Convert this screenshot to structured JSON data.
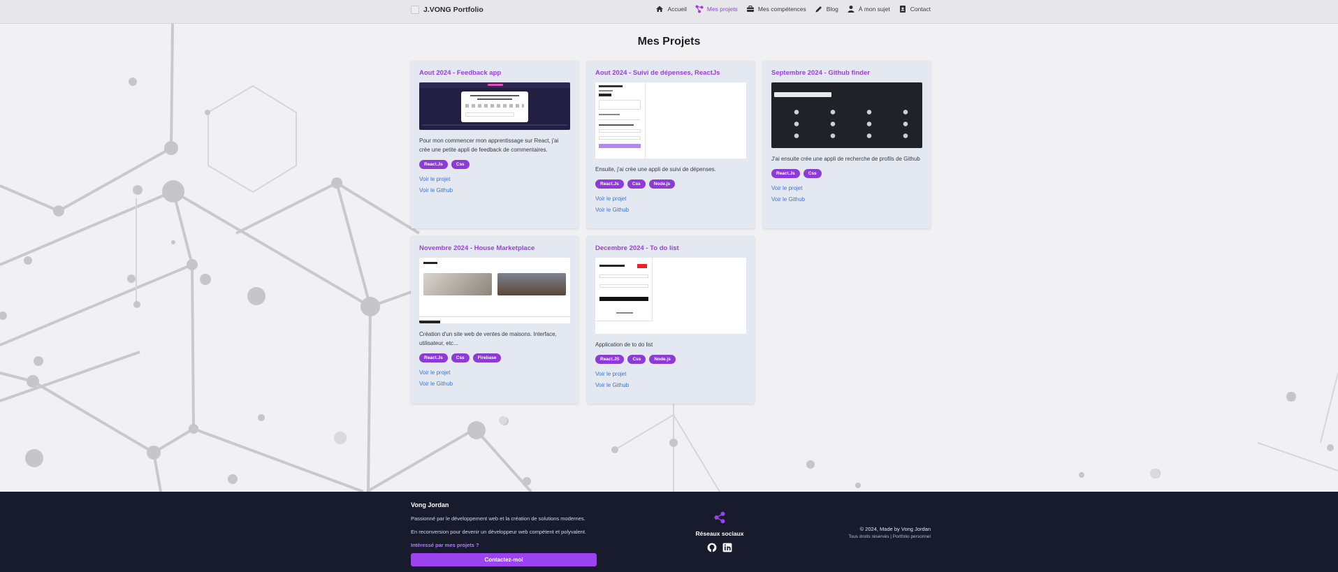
{
  "header": {
    "brand": "J.VONG Portfolio",
    "nav": [
      {
        "label": "Accueil",
        "icon": "home-icon",
        "active": false
      },
      {
        "label": "Mes projets",
        "icon": "share-nodes-icon",
        "active": true
      },
      {
        "label": "Mes compétences",
        "icon": "briefcase-icon",
        "active": false
      },
      {
        "label": "Blog",
        "icon": "pencil-icon",
        "active": false
      },
      {
        "label": "À mon sujet",
        "icon": "user-icon",
        "active": false
      },
      {
        "label": "Contact",
        "icon": "contact-book-icon",
        "active": false
      }
    ]
  },
  "main": {
    "title": "Mes Projets",
    "projects": [
      {
        "title": "Aout 2024 - Feedback app",
        "description": "Pour mon commencer mon apprentissage sur React, j'ai crée une petite appli de feedback de commentaires.",
        "tags": [
          "React.Js",
          "Css"
        ],
        "link_project": "Voir le projet",
        "link_github": "Voir le Github"
      },
      {
        "title": "Aout 2024 - Suivi de dépenses, ReactJs",
        "description": "Ensuite, j'ai crée une appli de suivi de dépenses.",
        "tags": [
          "React.Js",
          "Css",
          "Node.js"
        ],
        "link_project": "Voir le projet",
        "link_github": "Voir le Github"
      },
      {
        "title": "Septembre 2024 - Github finder",
        "description": "J'ai ensuite crée une appli de recherche de profils de Github",
        "tags": [
          "React.Js",
          "Css"
        ],
        "link_project": "Voir le projet",
        "link_github": "Voir le Github"
      },
      {
        "title": "Novembre 2024 - House Marketplace",
        "description": "Création d'un site web de ventes de maisons. Interface, utilisateur, etc...",
        "tags": [
          "React.Js",
          "Css",
          "Firebase"
        ],
        "link_project": "Voir le projet",
        "link_github": "Voir le Github"
      },
      {
        "title": "Decembre 2024 - To do list",
        "description": "Application de to do list",
        "tags": [
          "React.JS",
          "Css",
          "Node.js"
        ],
        "link_project": "Voir le projet",
        "link_github": "Voir le Github"
      }
    ]
  },
  "footer": {
    "name": "Vong Jordan",
    "line1": "Passionné par le développement web et la création de solutions modernes.",
    "line2": "En reconversion pour devenir un développeur web compétent et polyvalent.",
    "interest": "Intéressé par mes projets ?",
    "cta": "Contactez-moi",
    "social_title": "Réseaux sociaux",
    "copyright": "© 2024, Made by Vong Jordan",
    "rights": "Tous droits réservés | Portfolio personnel"
  },
  "colors": {
    "accent": "#9b3fe0",
    "link": "#3f72d8",
    "footer_bg": "#171b2c",
    "card_bg": "#e3e8f1"
  }
}
